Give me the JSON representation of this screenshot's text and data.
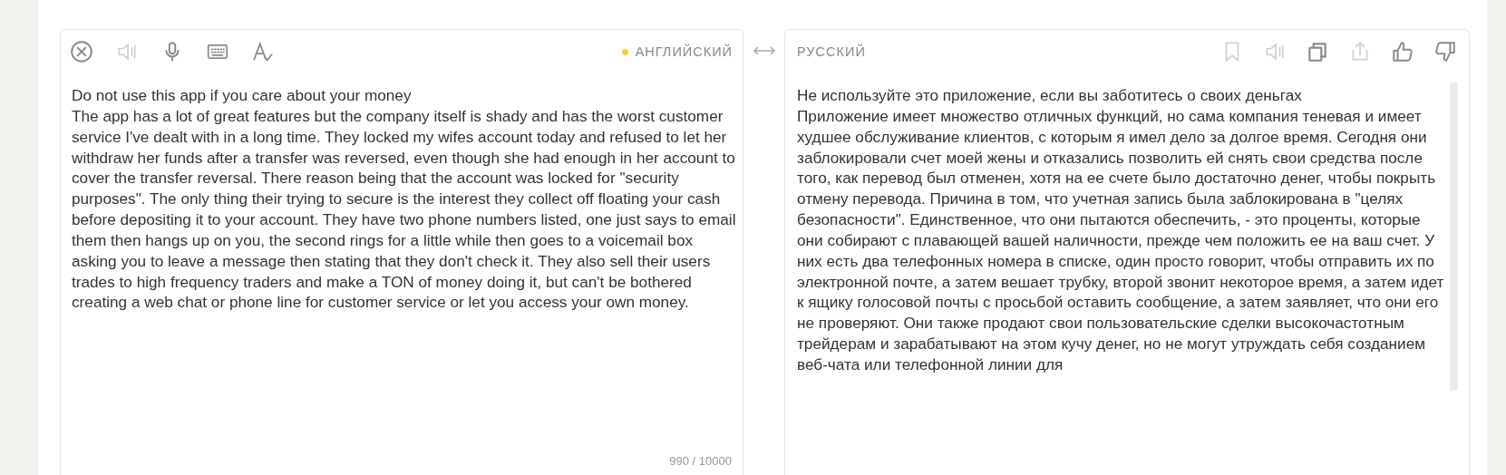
{
  "source": {
    "toolbar": [
      {
        "kind": "clear",
        "disabled": false
      },
      {
        "kind": "speaker",
        "disabled": true
      },
      {
        "kind": "microphone",
        "disabled": false
      },
      {
        "kind": "keyboard",
        "disabled": false
      },
      {
        "kind": "spellcheck",
        "disabled": false
      }
    ],
    "language": {
      "label": "АНГЛИЙСКИЙ",
      "color": "#ffcc33"
    },
    "text": "Do not use this app if you care about your money\nThe app has a lot of great features but the company itself is shady and has the worst customer service I've dealt with in a long time. They locked my wifes account today and refused to let her withdraw her funds after a transfer was reversed, even though she had enough in her account to cover the transfer reversal. There reason being that the account was locked for \"security purposes\". The only thing their trying to secure is the interest they collect off floating your cash before depositing it to your account. They have two phone numbers listed, one just says to email them then hangs up on you, the second rings for a little while then goes to a voicemail box asking you to leave a message then stating that they don't check it. They also sell their users trades to high frequency traders and make a TON of money doing it, but can't be bothered creating a web chat or phone line for customer service or let you access your own money.",
    "counter": "990 / 10000"
  },
  "target": {
    "language": {
      "label": "РУССКИЙ"
    },
    "toolbar": [
      {
        "kind": "bookmark",
        "disabled": true
      },
      {
        "kind": "speaker",
        "disabled": true
      },
      {
        "kind": "copy",
        "disabled": false
      },
      {
        "kind": "share",
        "disabled": true
      },
      {
        "kind": "like",
        "disabled": false
      },
      {
        "kind": "dislike",
        "disabled": false
      }
    ],
    "text": "Не используйте это приложение, если вы заботитесь о своих деньгах\nПриложение имеет множество отличных функций, но сама компания теневая и имеет худшее обслуживание клиентов, с которым я имел дело за долгое время. Сегодня они заблокировали счет моей жены и отказались позволить ей снять свои средства после того, как перевод был отменен, хотя на ее счете было достаточно денег, чтобы покрыть отмену перевода. Причина в том, что учетная запись была заблокирована в \"целях безопасности\". Единственное, что они пытаются обеспечить, - это проценты, которые они собирают с плавающей вашей наличности, прежде чем положить ее на ваш счет. У них есть два телефонных номера в списке, один просто говорит, чтобы отправить их по электронной почте, а затем вешает трубку, второй звонит некоторое время, а затем идет к ящику голосовой почты с просьбой оставить сообщение, а затем заявляет, что они его не проверяют. Они также продают свои пользовательские сделки высокочастотным трейдерам и зарабатывают на этом кучу денег, но не могут утруждать себя созданием веб-чата или телефонной линии для"
  }
}
